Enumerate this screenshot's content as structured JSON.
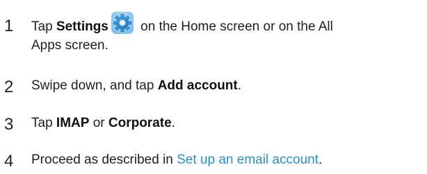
{
  "steps": [
    {
      "number": "1",
      "pre": "Tap ",
      "bold": "Settings",
      "after_icon": " on the Home screen or on the All",
      "line2": "Apps screen.",
      "icon": "settings-gear-icon"
    },
    {
      "number": "2",
      "pre": "Swipe down, and tap ",
      "bold": "Add account",
      "post": "."
    },
    {
      "number": "3",
      "pre": "Tap ",
      "bold1": "IMAP",
      "mid": " or ",
      "bold2": "Corporate",
      "post": "."
    },
    {
      "number": "4",
      "pre": "Proceed as described in ",
      "link": "Set up an email account",
      "post": "."
    }
  ],
  "colors": {
    "text": "#1f1f1f",
    "link": "#2a8fcf",
    "icon_blue": "#3a9be0"
  }
}
